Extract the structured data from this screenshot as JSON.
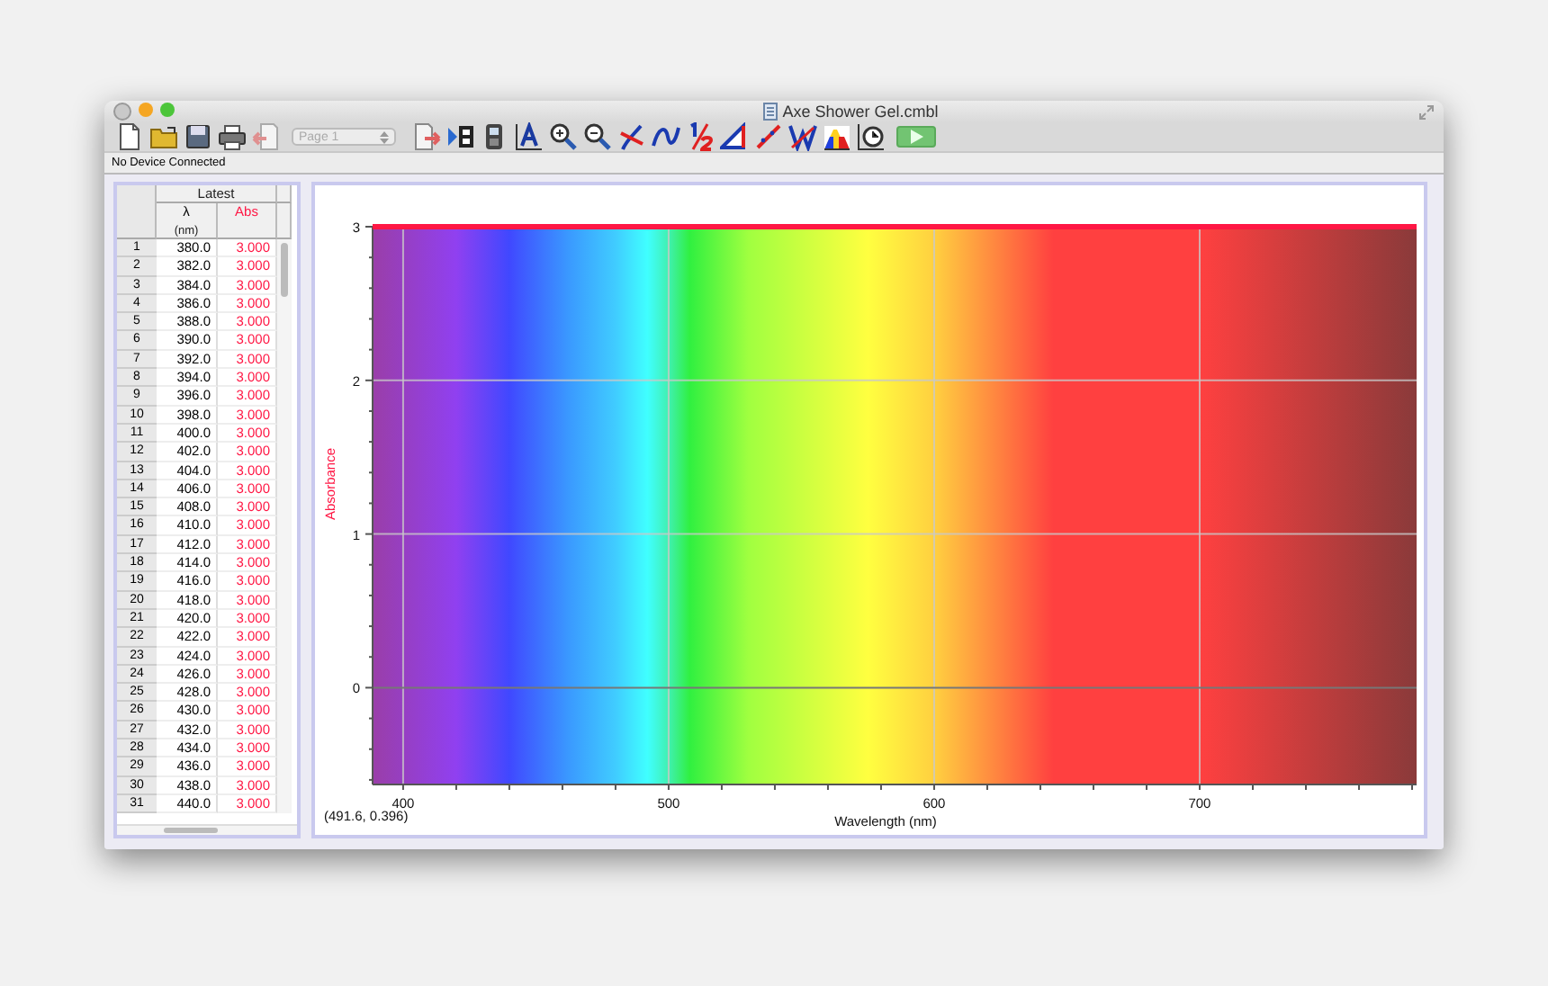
{
  "window": {
    "title": "Axe Shower Gel.cmbl"
  },
  "toolbar": {
    "page_select": "Page 1"
  },
  "status_bar": "No Device Connected",
  "table": {
    "group": "Latest",
    "columns": [
      {
        "label": "λ",
        "unit": "(nm)",
        "color": "#000000"
      },
      {
        "label": "Abs",
        "color": "#ff1744"
      }
    ],
    "rows": [
      {
        "n": "1",
        "values": [
          "380.0",
          "3.000"
        ]
      },
      {
        "n": "2",
        "values": [
          "382.0",
          "3.000"
        ]
      },
      {
        "n": "3",
        "values": [
          "384.0",
          "3.000"
        ]
      },
      {
        "n": "4",
        "values": [
          "386.0",
          "3.000"
        ]
      },
      {
        "n": "5",
        "values": [
          "388.0",
          "3.000"
        ]
      },
      {
        "n": "6",
        "values": [
          "390.0",
          "3.000"
        ]
      },
      {
        "n": "7",
        "values": [
          "392.0",
          "3.000"
        ]
      },
      {
        "n": "8",
        "values": [
          "394.0",
          "3.000"
        ]
      },
      {
        "n": "9",
        "values": [
          "396.0",
          "3.000"
        ]
      },
      {
        "n": "10",
        "values": [
          "398.0",
          "3.000"
        ]
      },
      {
        "n": "11",
        "values": [
          "400.0",
          "3.000"
        ]
      },
      {
        "n": "12",
        "values": [
          "402.0",
          "3.000"
        ]
      },
      {
        "n": "13",
        "values": [
          "404.0",
          "3.000"
        ]
      },
      {
        "n": "14",
        "values": [
          "406.0",
          "3.000"
        ]
      },
      {
        "n": "15",
        "values": [
          "408.0",
          "3.000"
        ]
      },
      {
        "n": "16",
        "values": [
          "410.0",
          "3.000"
        ]
      },
      {
        "n": "17",
        "values": [
          "412.0",
          "3.000"
        ]
      },
      {
        "n": "18",
        "values": [
          "414.0",
          "3.000"
        ]
      },
      {
        "n": "19",
        "values": [
          "416.0",
          "3.000"
        ]
      },
      {
        "n": "20",
        "values": [
          "418.0",
          "3.000"
        ]
      },
      {
        "n": "21",
        "values": [
          "420.0",
          "3.000"
        ]
      },
      {
        "n": "22",
        "values": [
          "422.0",
          "3.000"
        ]
      },
      {
        "n": "23",
        "values": [
          "424.0",
          "3.000"
        ]
      },
      {
        "n": "24",
        "values": [
          "426.0",
          "3.000"
        ]
      },
      {
        "n": "25",
        "values": [
          "428.0",
          "3.000"
        ]
      },
      {
        "n": "26",
        "values": [
          "430.0",
          "3.000"
        ]
      },
      {
        "n": "27",
        "values": [
          "432.0",
          "3.000"
        ]
      },
      {
        "n": "28",
        "values": [
          "434.0",
          "3.000"
        ]
      },
      {
        "n": "29",
        "values": [
          "436.0",
          "3.000"
        ]
      },
      {
        "n": "30",
        "values": [
          "438.0",
          "3.000"
        ]
      },
      {
        "n": "31",
        "values": [
          "440.0",
          "3.000"
        ]
      }
    ]
  },
  "graph": {
    "cursor_readout": "(491.6, 0.396)",
    "chart_data": {
      "type": "line",
      "xlabel": "Wavelength (nm)",
      "ylabel": "Absorbance",
      "x": [
        388.5,
        781.7
      ],
      "series": [
        {
          "color": "#ff1744",
          "values": [
            3,
            3
          ]
        }
      ],
      "grid": true,
      "xlim": [
        388.5,
        781.7
      ],
      "ylim": [
        -0.63,
        3
      ],
      "xticks": [
        400,
        500,
        600,
        700
      ],
      "yticks": [
        0,
        1,
        2,
        3
      ]
    }
  }
}
